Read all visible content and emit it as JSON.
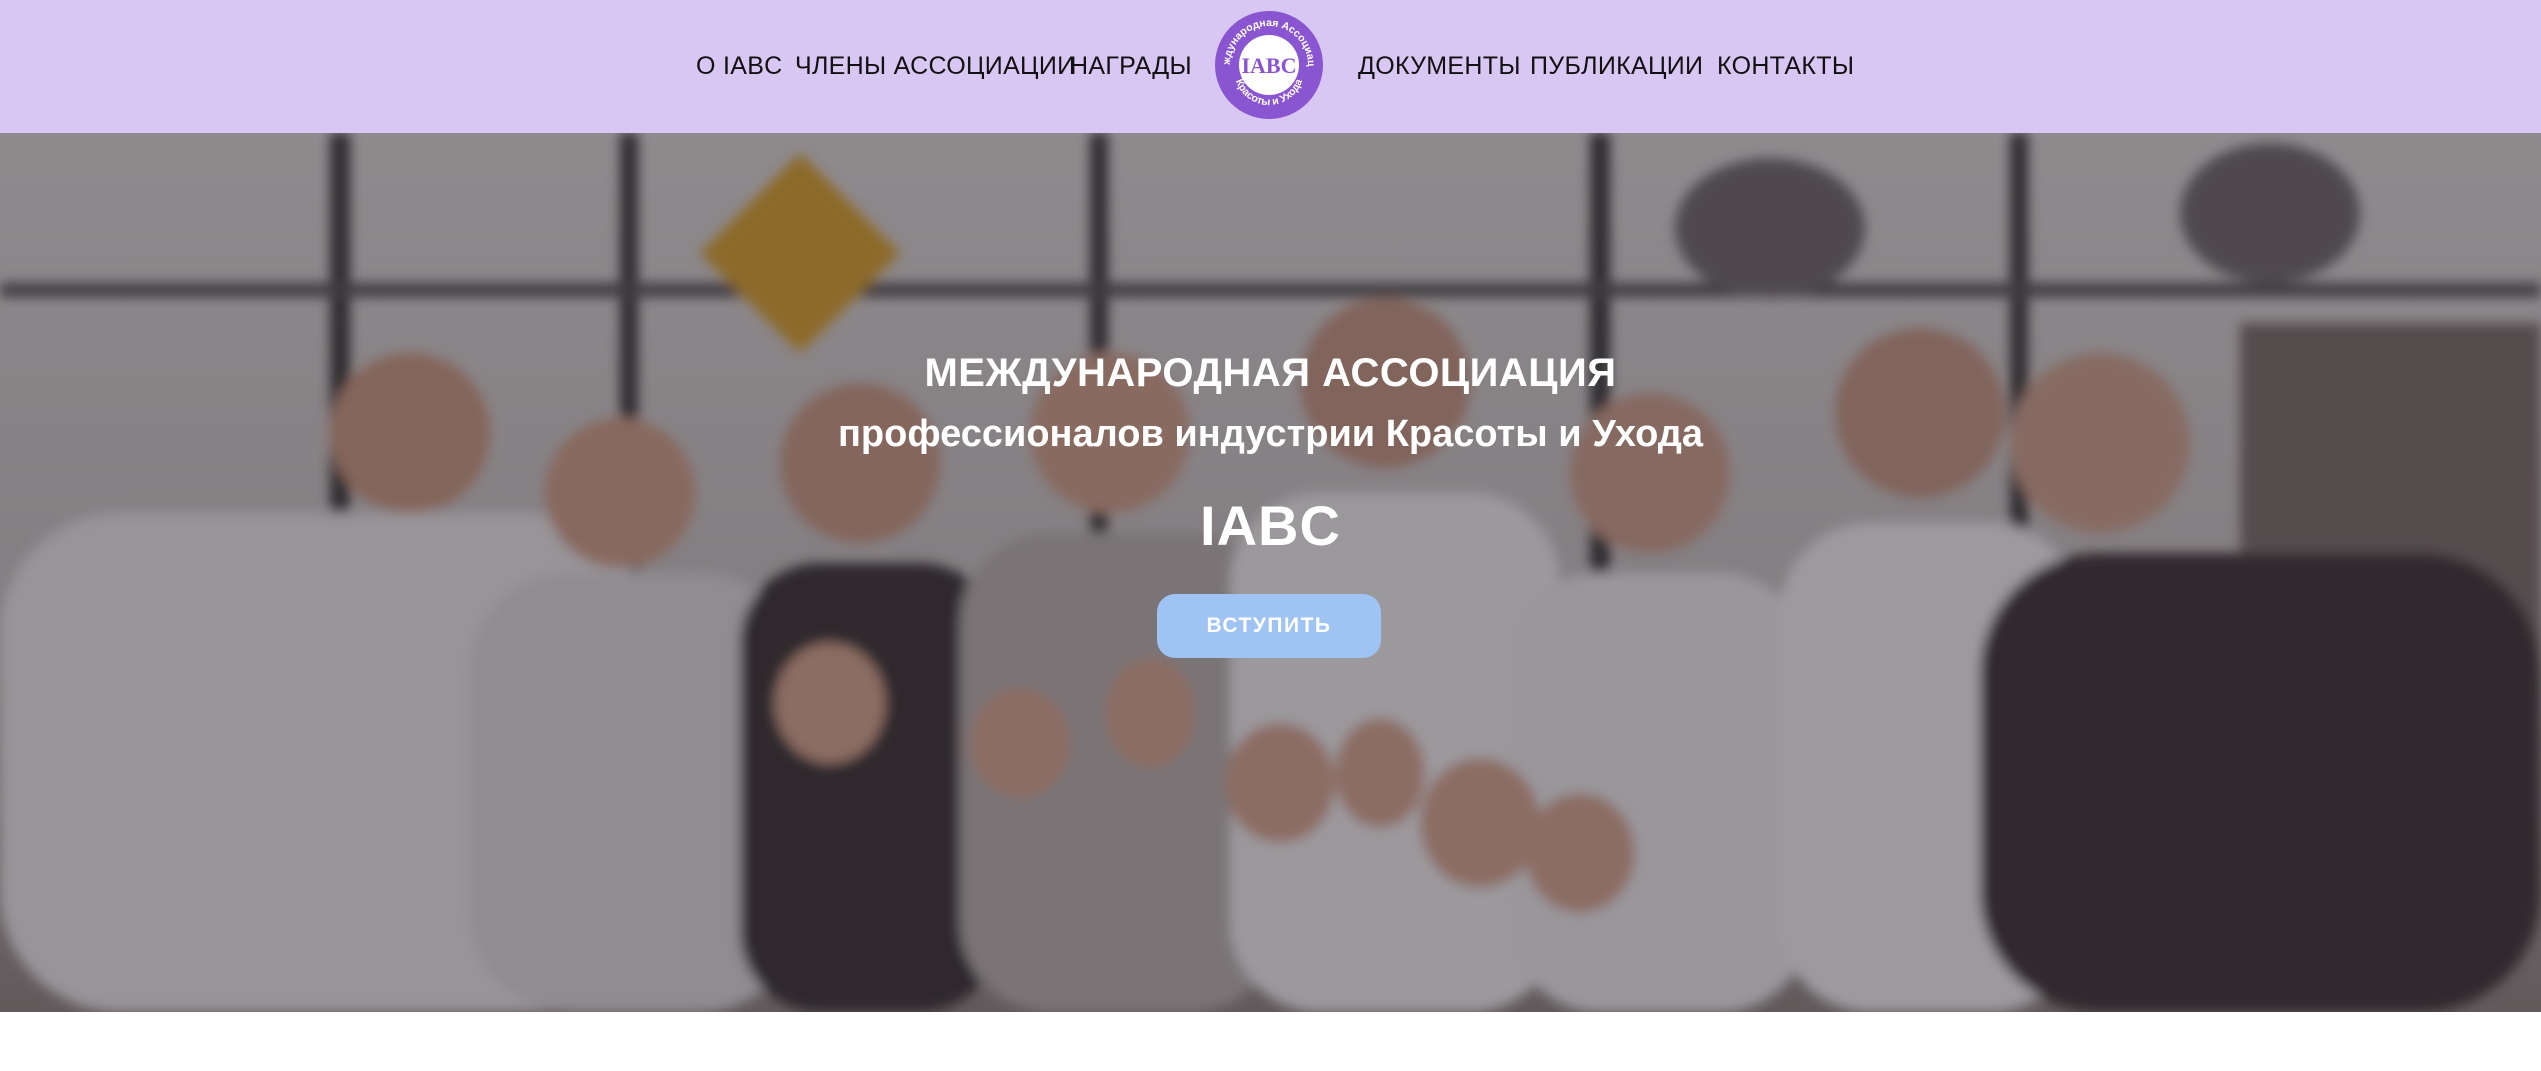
{
  "nav": {
    "left": [
      "О IABC",
      "ЧЛЕНЫ АССОЦИАЦИИ",
      "НАГРАДЫ"
    ],
    "right": [
      "ДОКУМЕНТЫ",
      "ПУБЛИКАЦИИ",
      "КОНТАКТЫ"
    ]
  },
  "logo": {
    "center_text": "IABC",
    "ring_text_top": "Международная Ассоциация",
    "ring_text_bottom": "Красоты и Ухода",
    "color": "#8a55d0"
  },
  "hero": {
    "title_line1": "МЕЖДУНАРОДНАЯ АССОЦИАЦИЯ",
    "title_line2": "профессионалов индустрии Красоты и Ухода",
    "title_line3": "IABC",
    "button_label": "ВСТУПИТЬ",
    "button_color": "#9fc3f3"
  },
  "colors": {
    "header_bg": "#d9c7f3"
  }
}
